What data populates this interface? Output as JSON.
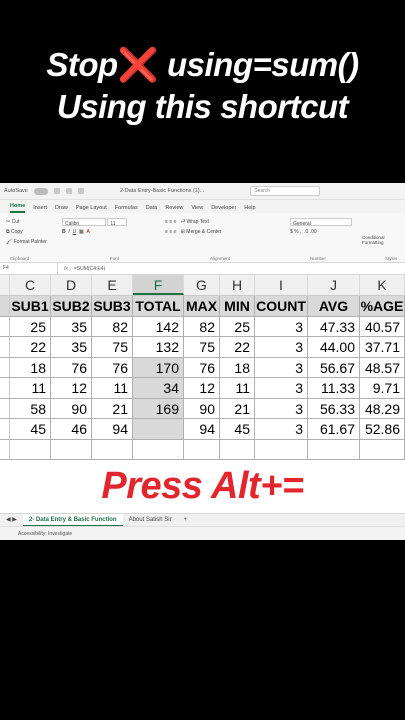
{
  "headline": {
    "line1_a": "Stop",
    "line1_mark": "❌",
    "line1_b": " using=sum()",
    "line2": "Using this shortcut"
  },
  "excel": {
    "titlebar": {
      "autosave": "AutoSave",
      "file_name": "2-Data Entry-Basic Functions (1)...",
      "search_placeholder": "Search"
    },
    "ribbon_tabs": [
      "Home",
      "Insert",
      "Draw",
      "Page Layout",
      "Formulas",
      "Data",
      "Review",
      "View",
      "Developer",
      "Help"
    ],
    "clipboard": {
      "cut": "Cut",
      "copy": "Copy",
      "format_painter": "Format Painter",
      "label": "Clipboard"
    },
    "font": {
      "name": "Calibri",
      "size": "11",
      "label": "Font"
    },
    "alignment": {
      "wrap": "Wrap Text",
      "merge": "Merge & Center",
      "label": "Alignment"
    },
    "number": {
      "format": "General",
      "label": "Number"
    },
    "styles": {
      "conditional": "Conditional Formatting",
      "label": "Styles"
    },
    "formula_bar": {
      "formula": "=SUM(C4:E4)",
      "fx": "fx"
    },
    "columns": [
      "C",
      "D",
      "E",
      "F",
      "G",
      "H",
      "I",
      "J",
      "K"
    ],
    "headers": [
      "SUB1",
      "SUB2",
      "SUB3",
      "TOTAL",
      "MAX",
      "MIN",
      "COUNT",
      "AVG",
      "%AGE"
    ],
    "rows": [
      [
        "25",
        "35",
        "82",
        "142",
        "82",
        "25",
        "3",
        "47.33",
        "40.57"
      ],
      [
        "22",
        "35",
        "75",
        "132",
        "75",
        "22",
        "3",
        "44.00",
        "37.71"
      ],
      [
        "18",
        "76",
        "76",
        "170",
        "76",
        "18",
        "3",
        "56.67",
        "48.57"
      ],
      [
        "11",
        "12",
        "11",
        "34",
        "12",
        "11",
        "3",
        "11.33",
        "9.71"
      ],
      [
        "58",
        "90",
        "21",
        "169",
        "90",
        "21",
        "3",
        "56.33",
        "48.29"
      ],
      [
        "45",
        "46",
        "94",
        "",
        "94",
        "45",
        "3",
        "61.67",
        "52.86"
      ]
    ],
    "sheet_tabs": [
      "2- Data Entry & Basic Function",
      "About Satish Sir"
    ],
    "add_sheet": "+",
    "status": "Accessibility: Investigate"
  },
  "overlay": {
    "press": "Press Alt+="
  }
}
